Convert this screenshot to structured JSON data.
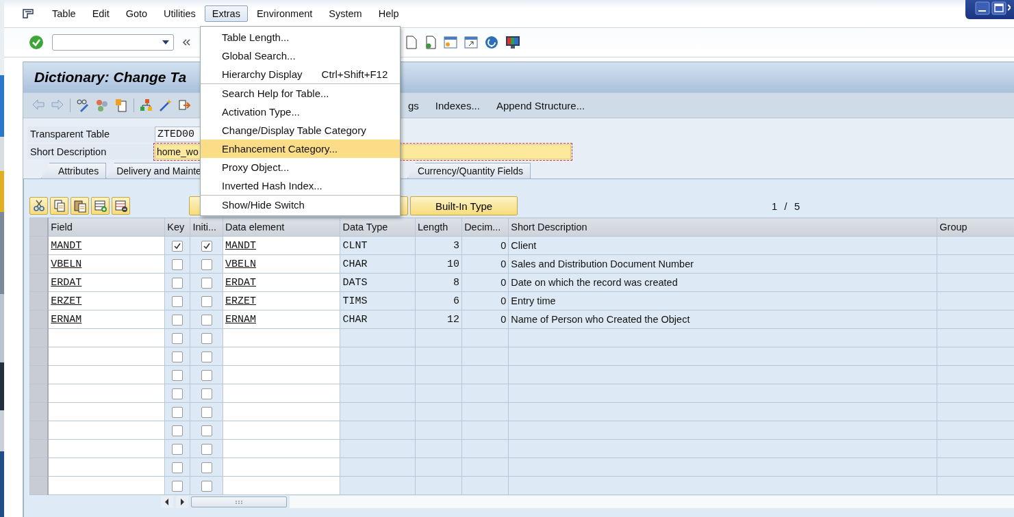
{
  "menu_bar": {
    "items": [
      {
        "label": "Table",
        "selected": false
      },
      {
        "label": "Edit",
        "selected": false
      },
      {
        "label": "Goto",
        "selected": false
      },
      {
        "label": "Utilities",
        "selected": false
      },
      {
        "label": "Extras",
        "selected": true
      },
      {
        "label": "Environment",
        "selected": false
      },
      {
        "label": "System",
        "selected": false
      },
      {
        "label": "Help",
        "selected": false
      }
    ]
  },
  "title": "Dictionary: Change Ta",
  "application_toolbar": {
    "buttons": [
      "gs",
      "Indexes...",
      "Append Structure..."
    ]
  },
  "header_fields": [
    {
      "label": "Transparent Table",
      "value": "ZTED00",
      "kind": "display"
    },
    {
      "label": "Short Description",
      "value": "home_wo",
      "kind": "input"
    }
  ],
  "tabs": [
    {
      "label": "Attributes",
      "selected": false
    },
    {
      "label": "Delivery and Mainte",
      "selected": false
    },
    {
      "label": "Currency/Quantity Fields",
      "selected": false
    }
  ],
  "table_toolbar": {
    "buttons": [
      "Built-In Type"
    ],
    "page": "1 / 5"
  },
  "table": {
    "columns": [
      "Field",
      "Key",
      "Initi...",
      "Data element",
      "Data Type",
      "Length",
      "Decim...",
      "Short Description",
      "Group"
    ],
    "rows": [
      {
        "field": "MANDT",
        "key": true,
        "initial": true,
        "data_element": "MANDT",
        "data_type": "CLNT",
        "length": "3",
        "decimals": "0",
        "short_description": "Client"
      },
      {
        "field": "VBELN",
        "key": false,
        "initial": false,
        "data_element": "VBELN",
        "data_type": "CHAR",
        "length": "10",
        "decimals": "0",
        "short_description": "Sales and Distribution Document Number"
      },
      {
        "field": "ERDAT",
        "key": false,
        "initial": false,
        "data_element": "ERDAT",
        "data_type": "DATS",
        "length": "8",
        "decimals": "0",
        "short_description": "Date on which the record was created"
      },
      {
        "field": "ERZET",
        "key": false,
        "initial": false,
        "data_element": "ERZET",
        "data_type": "TIMS",
        "length": "6",
        "decimals": "0",
        "short_description": "Entry time"
      },
      {
        "field": "ERNAM",
        "key": false,
        "initial": false,
        "data_element": "ERNAM",
        "data_type": "CHAR",
        "length": "12",
        "decimals": "0",
        "short_description": "Name of Person who Created the Object"
      },
      {
        "key": false,
        "initial": false
      },
      {
        "key": false,
        "initial": false
      },
      {
        "key": false,
        "initial": false
      },
      {
        "key": false,
        "initial": false
      },
      {
        "key": false,
        "initial": false
      },
      {
        "key": false,
        "initial": false
      },
      {
        "key": false,
        "initial": false
      },
      {
        "key": false,
        "initial": false
      },
      {
        "key": false,
        "initial": false
      }
    ]
  },
  "dropdown_menu": {
    "groups": [
      {
        "items": [
          {
            "label": "Table Length...",
            "selected": false
          },
          {
            "label": "Global Search...",
            "selected": false
          },
          {
            "label": "Hierarchy Display",
            "shortcut": "Ctrl+Shift+F12",
            "selected": false
          }
        ]
      },
      {
        "items": [
          {
            "label": "Search Help for Table...",
            "selected": false
          },
          {
            "label": "Activation Type...",
            "selected": false
          },
          {
            "label": "Change/Display Table Category",
            "selected": false
          },
          {
            "label": "Enhancement Category...",
            "selected": true
          },
          {
            "label": "Proxy Object...",
            "selected": false
          },
          {
            "label": "Inverted Hash Index...",
            "selected": false
          }
        ]
      },
      {
        "items": [
          {
            "label": "Show/Hide Switch",
            "selected": false
          }
        ]
      }
    ]
  }
}
